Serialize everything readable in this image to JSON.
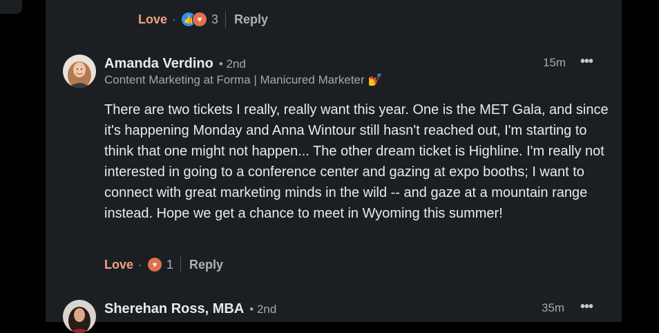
{
  "top_comment_actions": {
    "love": "Love",
    "separator": "·",
    "reaction_count": "3",
    "reply": "Reply",
    "reactions": [
      "like-icon",
      "heart-icon"
    ]
  },
  "comment1": {
    "author": "Amanda Verdino",
    "degree": "• 2nd",
    "headline": "Content Marketing at Forma | Manicured Marketer",
    "headline_emoji": "💅",
    "time": "15m",
    "more": "•••",
    "body": "There are two tickets I really, really want this year. One is the MET Gala, and since it's happening Monday and Anna Wintour still hasn't reached out, I'm starting to think that one might not happen... The other dream ticket is Highline. I'm really not interested in going to a conference center and gazing at expo booths; I want to connect with great marketing minds in the wild -- and gaze at a mountain range instead. Hope we get a chance to meet in Wyoming this summer!",
    "actions": {
      "love": "Love",
      "separator": "·",
      "reaction_count": "1",
      "reply": "Reply"
    }
  },
  "comment2": {
    "author": "Sherehan Ross, MBA",
    "degree": "• 2nd",
    "time": "35m",
    "more": "•••"
  },
  "colors": {
    "panel": "#1b1f23",
    "love": "#f3a27f",
    "like_icon": "#378fe9",
    "heart_icon": "#df704d"
  }
}
